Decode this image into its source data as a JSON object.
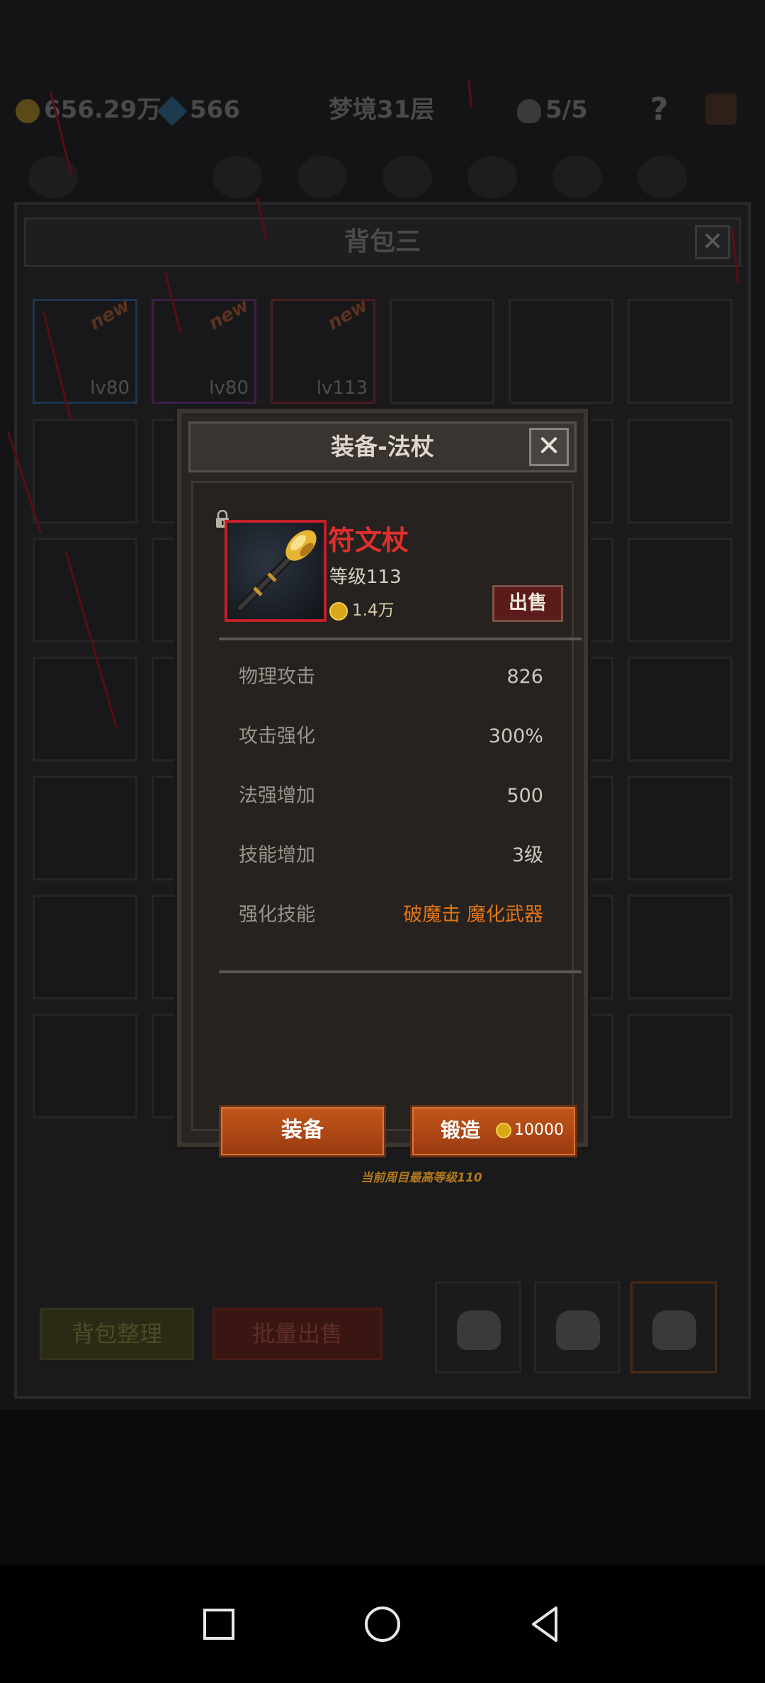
{
  "background": {
    "currency": {
      "gold": "656.29万",
      "gems": "566"
    },
    "dream_level": "梦境31层",
    "skull_count": "5/5",
    "help": "?",
    "bag": {
      "title": "背包三",
      "close": "✕",
      "slots": [
        {
          "level": "lv80",
          "new": "new",
          "rarity": "blue"
        },
        {
          "level": "lv80",
          "new": "new",
          "rarity": "purple"
        },
        {
          "level": "lv113",
          "new": "new",
          "rarity": "red"
        }
      ],
      "sort_label": "背包整理",
      "batch_sell_label": "批量出售"
    }
  },
  "modal": {
    "title": "装备-法杖",
    "close": "✕",
    "item": {
      "name": "符文杖",
      "level": "等级113",
      "price": "1.4万",
      "sell_label": "出售",
      "frame_color": "#c3202a"
    },
    "stats": [
      {
        "label": "物理攻击",
        "value": "826"
      },
      {
        "label": "攻击强化",
        "value": "300%"
      },
      {
        "label": "法强增加",
        "value": "500"
      },
      {
        "label": "技能增加",
        "value": "3级"
      },
      {
        "label": "强化技能",
        "value": "破魔击 魔化武器"
      }
    ],
    "equip_label": "装备",
    "forge_label": "锻造",
    "forge_cost": "10000",
    "hint": "当前周目最高等级110"
  },
  "colors": {
    "accent_orange": "#c2571a",
    "item_name_red": "#e0302e",
    "skill_orange": "#e07418"
  }
}
